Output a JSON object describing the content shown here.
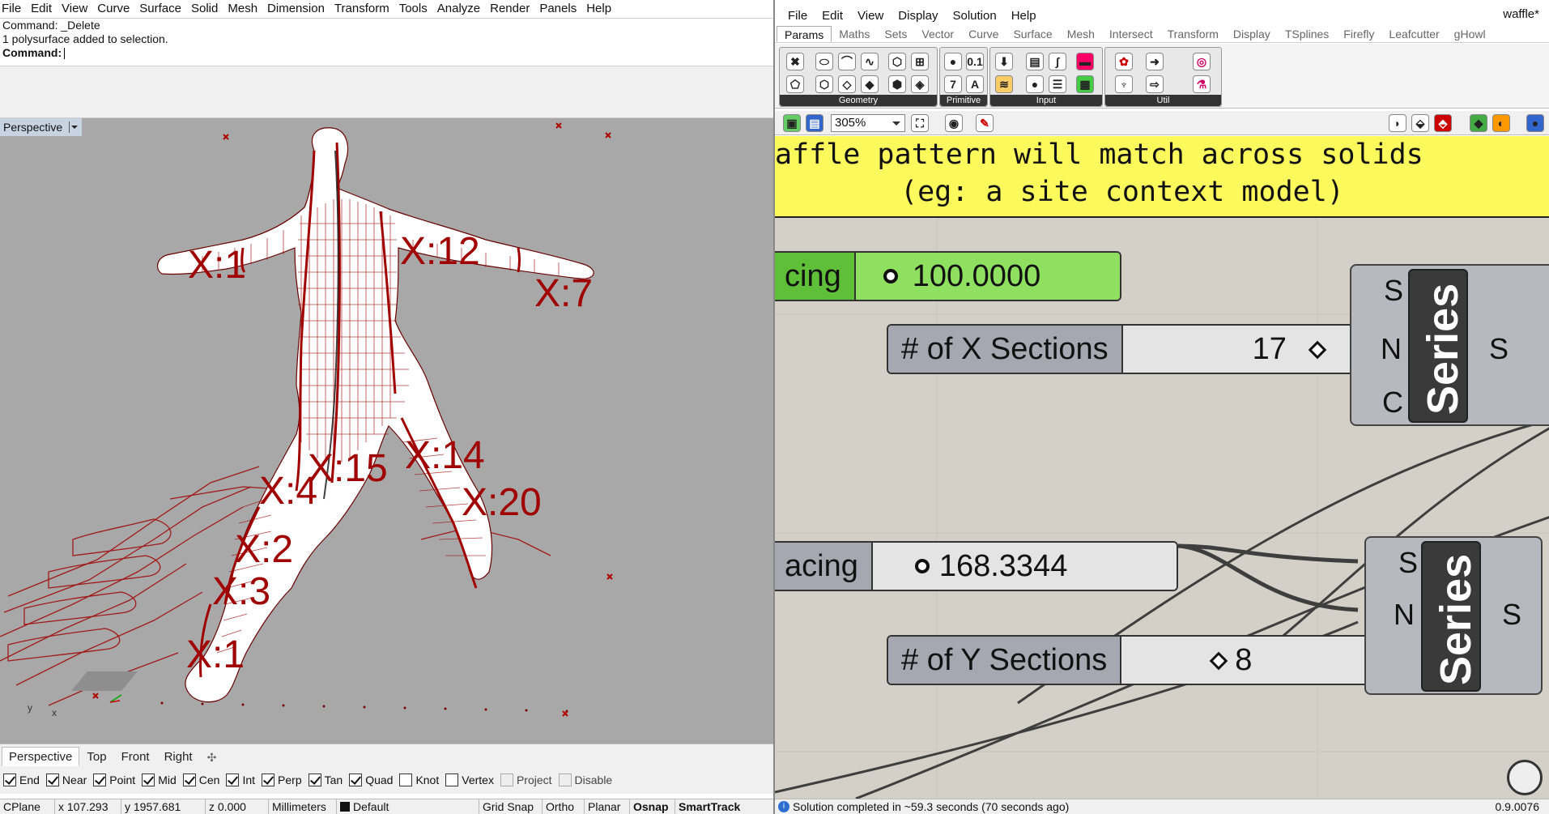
{
  "rhino": {
    "menu": [
      "File",
      "Edit",
      "View",
      "Curve",
      "Surface",
      "Solid",
      "Mesh",
      "Dimension",
      "Transform",
      "Tools",
      "Analyze",
      "Render",
      "Panels",
      "Help"
    ],
    "command_history": [
      "Command: _Delete",
      "1 polysurface added to selection."
    ],
    "command_prompt": "Command:",
    "viewport_title": "Perspective",
    "view_tabs": [
      "Perspective",
      "Top",
      "Front",
      "Right"
    ],
    "osnaps": [
      {
        "label": "End",
        "checked": true
      },
      {
        "label": "Near",
        "checked": true
      },
      {
        "label": "Point",
        "checked": true
      },
      {
        "label": "Mid",
        "checked": true
      },
      {
        "label": "Cen",
        "checked": true
      },
      {
        "label": "Int",
        "checked": true
      },
      {
        "label": "Perp",
        "checked": true
      },
      {
        "label": "Tan",
        "checked": true
      },
      {
        "label": "Quad",
        "checked": true
      },
      {
        "label": "Knot",
        "checked": false
      },
      {
        "label": "Vertex",
        "checked": false
      },
      {
        "label": "Project",
        "checked": false,
        "disabled": true
      },
      {
        "label": "Disable",
        "checked": false,
        "disabled": true
      }
    ],
    "status": {
      "cplane": "CPlane",
      "x": "x 107.293",
      "y": "y 1957.681",
      "z": "z 0.000",
      "units": "Millimeters",
      "layer": "Default",
      "grid_snap": "Grid Snap",
      "ortho": "Ortho",
      "planar": "Planar",
      "osnap": "Osnap",
      "smarttrack": "SmartTrack"
    },
    "labels": {
      "x1": "X:1",
      "x2": "X:2",
      "x3": "X:3",
      "x14": "X:14",
      "x15": "X:15",
      "x4": "X:4",
      "x1b": "X:1",
      "x12": "X:12",
      "x20": "X:20",
      "x17": "X:7"
    },
    "axis_labels": {
      "x": "x",
      "y": "y"
    },
    "colors": {
      "section": "#a00000",
      "viewport_bg": "#a8a8a8"
    }
  },
  "gh": {
    "menu": [
      "File",
      "Edit",
      "View",
      "Display",
      "Solution",
      "Help"
    ],
    "document": "waffle*",
    "tabs": [
      "Params",
      "Maths",
      "Sets",
      "Vector",
      "Curve",
      "Surface",
      "Mesh",
      "Intersect",
      "Transform",
      "Display",
      "TSplines",
      "Firefly",
      "Leafcutter",
      "gHowl"
    ],
    "panels": [
      "Geometry",
      "Primitive",
      "Input",
      "Util"
    ],
    "zoom": "305%",
    "note": {
      "line1": "affle pattern will match across solids",
      "line2": "(eg: a site context model)"
    },
    "sliders": {
      "spacing_x": {
        "name": "cing",
        "value": "100.0000"
      },
      "x_sections": {
        "name": "# of X Sections",
        "value": "17"
      },
      "spacing_y": {
        "name": "acing",
        "value": "168.3344"
      },
      "y_sections": {
        "name": "# of Y Sections",
        "value": "8"
      }
    },
    "series1": {
      "title": "Series",
      "inputs": [
        "S",
        "N",
        "C"
      ],
      "output": "S"
    },
    "series2": {
      "title": "Series",
      "inputs": [
        "S",
        "N"
      ],
      "output": "S"
    },
    "status": "Solution completed in ~59.3 seconds (70 seconds ago)",
    "version": "0.9.0076",
    "colors": {
      "note": "#fcf95c",
      "slider_green": "#8fe060",
      "wire_green": "#77cc3a",
      "canvas": "#d4d0c8"
    }
  }
}
